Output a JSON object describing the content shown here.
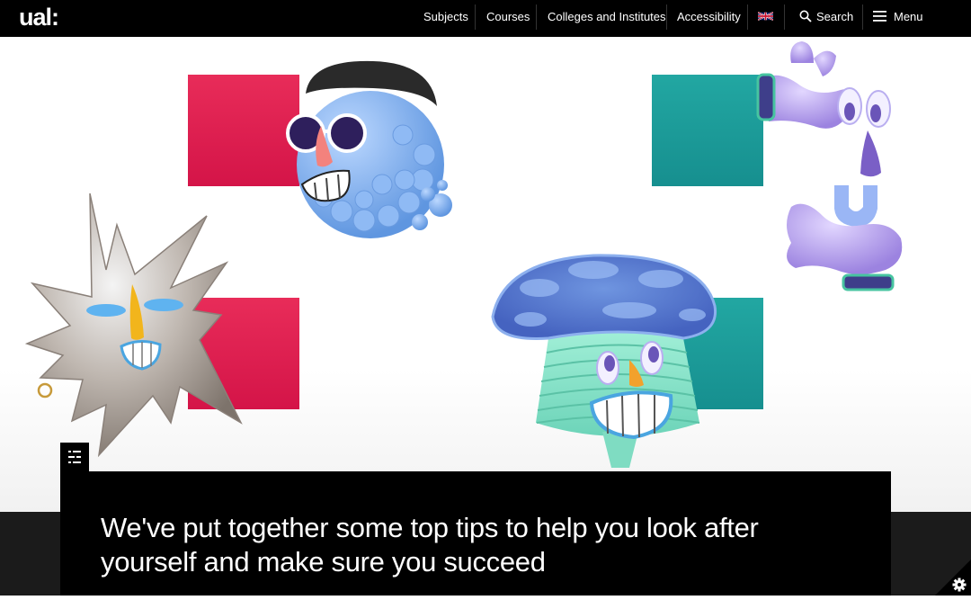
{
  "header": {
    "logo": "ual:",
    "nav": [
      {
        "label": "Subjects"
      },
      {
        "label": "Courses"
      },
      {
        "label": "Colleges and Institutes"
      },
      {
        "label": "Accessibility"
      }
    ],
    "language_icon": "uk-flag-icon",
    "search": {
      "label": "Search",
      "icon": "search-icon"
    },
    "menu": {
      "label": "Menu",
      "icon": "hamburger-icon"
    }
  },
  "hero": {
    "colors": {
      "pink": "#e21d4f",
      "teal": "#1d9f9f"
    },
    "characters": [
      "balloon-head-character",
      "hand-eyes-character",
      "chrome-splash-character",
      "mushroom-character"
    ]
  },
  "caption": {
    "text": "We've put together some top tips to help you look after yourself and make sure you succeed",
    "toc_icon": "table-of-contents-icon"
  },
  "cookie_settings_icon": "gear-icon"
}
